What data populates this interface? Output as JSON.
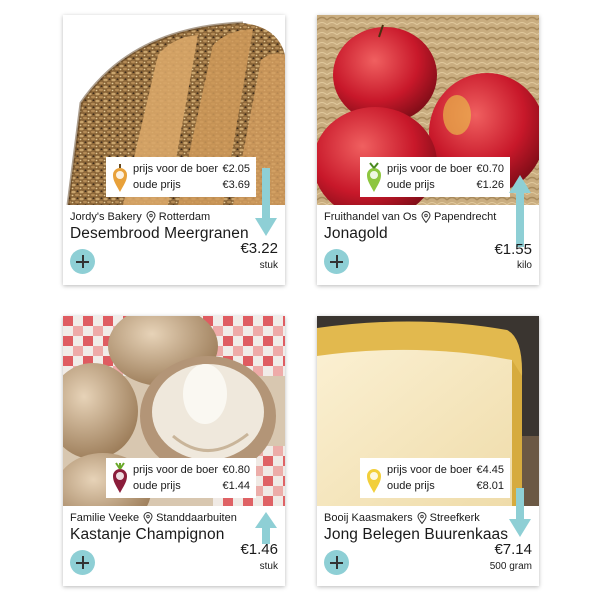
{
  "labels": {
    "farmer_price": "prijs voor de boer",
    "old_price": "oude prijs"
  },
  "colors": {
    "accent": "#8ecfd5",
    "arrow": "#8ecfd5"
  },
  "cards": [
    {
      "image": "bread-loaf-photo",
      "pin_icon": "pumpkin-pin-icon",
      "pin_color": "#e8a13a",
      "trend": "down",
      "farmer_price": "€2.05",
      "old_price": "€3.69",
      "shop": "Jordy's Bakery",
      "location": "Rotterdam",
      "product": "Desembrood Meergranen",
      "price": "€3.22",
      "unit": "stuk"
    },
    {
      "image": "red-apples-photo",
      "pin_icon": "pear-pin-icon",
      "pin_color": "#8dc63f",
      "trend": "up",
      "farmer_price": "€0.70",
      "old_price": "€1.26",
      "shop": "Fruithandel van Os",
      "location": "Papendrecht",
      "product": "Jonagold",
      "price": "€1.55",
      "unit": "kilo"
    },
    {
      "image": "mushrooms-photo",
      "pin_icon": "beet-pin-icon",
      "pin_color": "#8b1d3b",
      "trend": "up",
      "farmer_price": "€0.80",
      "old_price": "€1.44",
      "shop": "Familie Veeke",
      "location": "Standdaarbuiten",
      "product": "Kastanje Champignon",
      "price": "€1.46",
      "unit": "stuk"
    },
    {
      "image": "cheese-wedge-photo",
      "pin_icon": "cheese-pin-icon",
      "pin_color": "#f2cf3b",
      "trend": "down",
      "farmer_price": "€4.45",
      "old_price": "€8.01",
      "shop": "Booij Kaasmakers",
      "location": "Streefkerk",
      "product": "Jong Belegen Buurenkaas",
      "price": "€7.14",
      "unit": "500 gram"
    }
  ]
}
